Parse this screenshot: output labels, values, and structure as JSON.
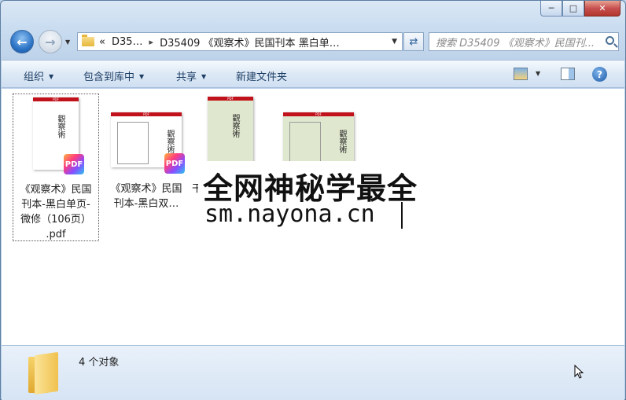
{
  "window": {
    "controls": {
      "minimize": "─",
      "maximize": "□",
      "close": "✕"
    }
  },
  "nav": {
    "back_icon": "←",
    "forward_icon": "→",
    "breadcrumb": [
      "«",
      "D35…",
      "D35409 《观察术》民国刊本 黑白单…"
    ],
    "search_placeholder": "搜索 D35409 《观察术》民国刊..."
  },
  "toolbar": {
    "organize": "组织",
    "include_in_library": "包含到库中",
    "share": "共享",
    "new_folder": "新建文件夹",
    "help": "?"
  },
  "files": [
    {
      "label": "《观察术》民国刊本-黑白单页-微修（106页）.pdf",
      "lines": [
        "《观察术》民国",
        "刊本-黑白单页-",
        "微修（106页）",
        ".pdf"
      ],
      "glyphs": "觀察術",
      "selected": true
    },
    {
      "label": "《观察术》民国刊本-黑白双…",
      "lines": [
        "《观察术》民国",
        "刊本-黑白双…"
      ],
      "glyphs": "觀察術",
      "selected": false
    },
    {
      "label": "干…",
      "lines": [
        "干"
      ],
      "glyphs": "觀察術",
      "selected": false
    },
    {
      "label": "",
      "lines": [],
      "glyphs": "觀察術",
      "selected": false
    }
  ],
  "badge_text": "PDF",
  "thumb_header": "PDF",
  "watermark": {
    "line1": "全网神秘学最全",
    "line2": "sm.nayona.cn"
  },
  "status": "4 个对象",
  "colors": {
    "accent": "#c1121c",
    "selection": "#555555",
    "background": "#ffffff"
  }
}
